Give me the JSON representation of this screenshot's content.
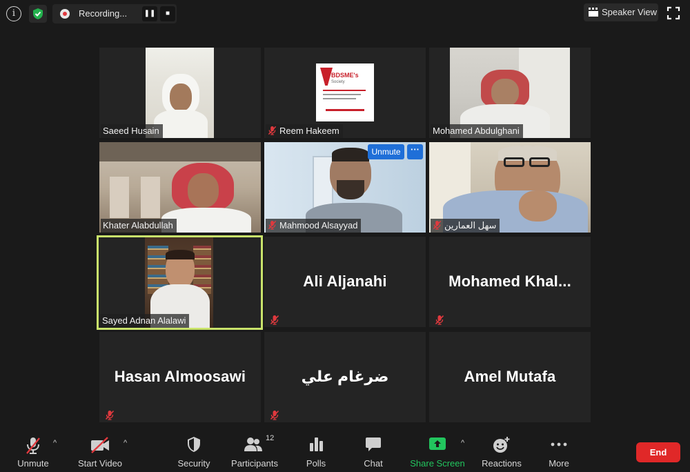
{
  "top_bar": {
    "info_icon": "info-icon",
    "encryption_icon": "shield-check-icon",
    "recording_label": "Recording...",
    "pause_icon": "pause-icon",
    "stop_icon": "stop-icon",
    "view_button_label": "Speaker View",
    "fullscreen_icon": "fullscreen-icon"
  },
  "participants": [
    {
      "name": "Saeed Husain",
      "muted": false,
      "video": true
    },
    {
      "name": "Reem Hakeem",
      "muted": true,
      "video": true
    },
    {
      "name": "Mohamed Abdulghani",
      "muted": false,
      "video": true
    },
    {
      "name": "Khater Alabdullah",
      "muted": false,
      "video": true
    },
    {
      "name": "Mahmood Alsayyad",
      "muted": true,
      "video": true
    },
    {
      "name": "سهل العمارين",
      "muted": true,
      "video": true
    },
    {
      "name": "Sayed Adnan Alalawi",
      "muted": false,
      "video": true,
      "active_speaker": true
    },
    {
      "name": "Ali Aljanahi",
      "muted": true,
      "video": false
    },
    {
      "name": "Mohamed  Khal...",
      "muted": true,
      "video": false
    },
    {
      "name": "Hasan Almoosawi",
      "muted": true,
      "video": false
    },
    {
      "name": "ضرغام علي",
      "muted": true,
      "video": false
    },
    {
      "name": "Amel Mutafa",
      "muted": false,
      "video": false
    }
  ],
  "tile_overlay": {
    "unmute_label": "Unmute",
    "more_label": "···"
  },
  "logo_text": "BDSME's Society",
  "toolbar": {
    "unmute": "Unmute",
    "start_video": "Start Video",
    "security": "Security",
    "participants": "Participants",
    "participants_count": "12",
    "polls": "Polls",
    "chat": "Chat",
    "share_screen": "Share Screen",
    "reactions": "Reactions",
    "more": "More",
    "end": "End"
  },
  "colors": {
    "background": "#1a1a1a",
    "tile": "#242424",
    "active_border": "#c9e36b",
    "share_green": "#22c55e",
    "end_red": "#e02828",
    "mute_red": "#e0393e",
    "unmute_blue": "#1f6fd8"
  }
}
